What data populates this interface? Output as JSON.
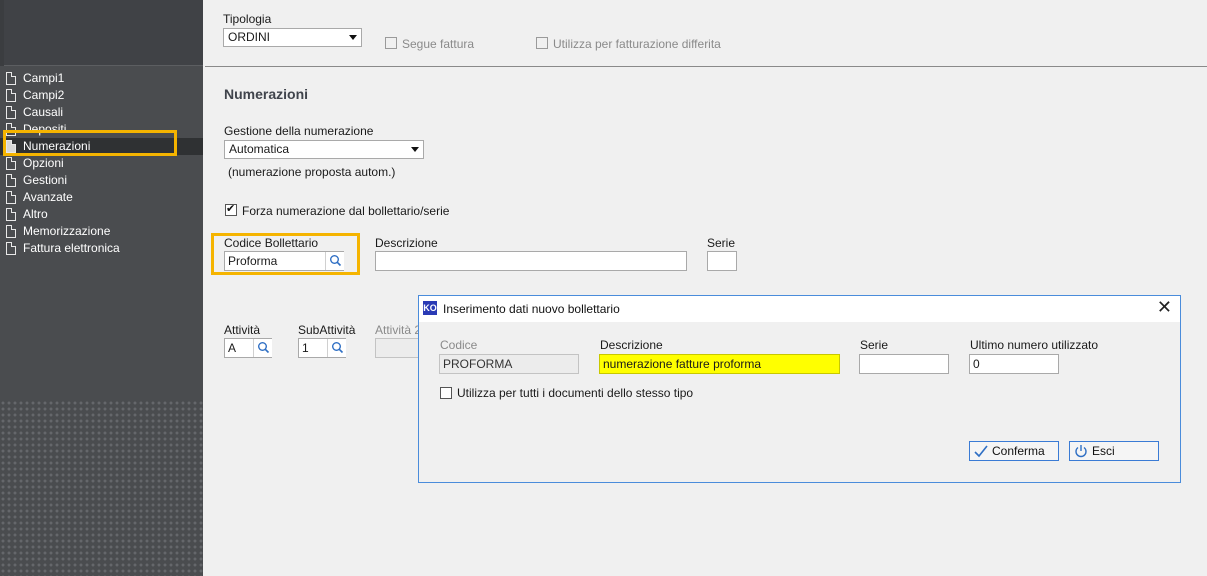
{
  "sidebar": {
    "items": [
      {
        "label": "Campi1",
        "active": false
      },
      {
        "label": "Campi2",
        "active": false
      },
      {
        "label": "Causali",
        "active": false
      },
      {
        "label": "Depositi",
        "active": false
      },
      {
        "label": "Numerazioni",
        "active": true
      },
      {
        "label": "Opzioni",
        "active": false
      },
      {
        "label": "Gestioni",
        "active": false
      },
      {
        "label": "Avanzate",
        "active": false
      },
      {
        "label": "Altro",
        "active": false
      },
      {
        "label": "Memorizzazione",
        "active": false
      },
      {
        "label": "Fattura elettronica",
        "active": false
      }
    ]
  },
  "header": {
    "tipologia_label": "Tipologia",
    "tipologia_value": "ORDINI",
    "segue_fattura_label": "Segue fattura",
    "differita_label": "Utilizza per fatturazione differita"
  },
  "numerazioni": {
    "title": "Numerazioni",
    "gestione_label": "Gestione della numerazione",
    "gestione_value": "Automatica",
    "gestione_note": "(numerazione proposta autom.)",
    "forza_label": "Forza numerazione dal bollettario/serie",
    "forza_checked": true,
    "codice_label": "Codice Bollettario",
    "codice_value": "Proforma",
    "descrizione_label": "Descrizione",
    "descrizione_value": "",
    "serie_label": "Serie",
    "serie_value": "",
    "attivita_label": "Attività",
    "attivita_value": "A",
    "subattivita_label": "SubAttività",
    "subattivita_value": "1",
    "attivita2_label": "Attività 2"
  },
  "dialog": {
    "title": "Inserimento dati nuovo bollettario",
    "codice_label": "Codice",
    "codice_value": "PROFORMA",
    "descrizione_label": "Descrizione",
    "descrizione_value": "numerazione fatture proforma",
    "serie_label": "Serie",
    "serie_value": "",
    "ultimo_label": "Ultimo numero utilizzato",
    "ultimo_value": "0",
    "utilizza_label": "Utilizza per tutti i documenti dello stesso tipo",
    "conferma_label": "Conferma",
    "esci_label": "Esci"
  },
  "colors": {
    "highlight": "#f5b400",
    "sidebar_bg": "#4a4c4f",
    "dialog_border": "#4a8cdb",
    "field_yellow": "#ffff00"
  }
}
